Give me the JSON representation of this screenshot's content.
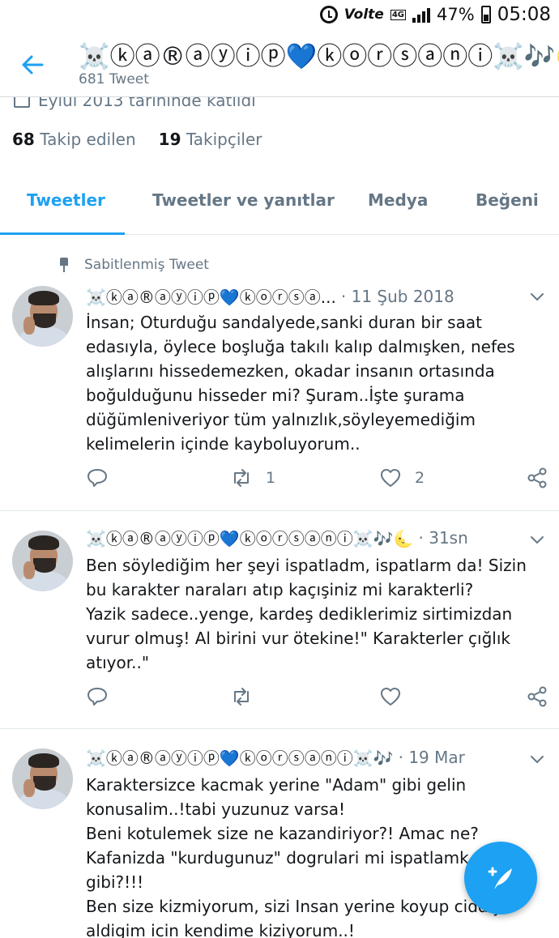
{
  "status_bar": {
    "network": "Volte",
    "network_type": "4G",
    "battery": "47%",
    "time": "05:08",
    "icons": [
      "alarm-icon",
      "signal-icon",
      "battery-icon"
    ]
  },
  "header": {
    "display_name": "☠️ⓚⓐ®ⓐⓨⓘⓟ💙ⓚⓞⓡⓢⓐⓝⓘ☠️🎶🌜",
    "tweet_count": "681 Tweet"
  },
  "profile": {
    "joined": "Eylül 2013 tarihinde katıldı",
    "following_count": "68",
    "following_label": "Takip edilen",
    "followers_count": "19",
    "followers_label": "Takipçiler"
  },
  "tabs": [
    {
      "label": "Tweetler"
    },
    {
      "label": "Tweetler ve yanıtlar"
    },
    {
      "label": "Medya"
    },
    {
      "label": "Beğeni"
    }
  ],
  "tweets": [
    {
      "pinned_label": "Sabitlenmiş Tweet",
      "name": "☠️ⓚⓐ®ⓐⓨⓘⓟ💙ⓚⓞⓡⓢⓐ...",
      "time": "· 11 Şub 2018",
      "text": "İnsan; Oturduğu sandalyede,sanki duran bir saat\nedasıyla, öylece boşluğa takılı kalıp dalmışken, nefes\nalışlarını hissedemezken, okadar insanın ortasında\nboğulduğunu hisseder mi? Şuram..İşte şurama\ndüğümleniveriyor tüm yalnızlık,söyleyemediğim\nkelimelerin içinde kayboluyorum..",
      "retweets": "1",
      "likes": "2"
    },
    {
      "name": "☠️ⓚⓐ®ⓐⓨⓘⓟ💙ⓚⓞⓡⓢⓐⓝⓘ☠️🎶🌜",
      "time": "· 31sn",
      "text": "Ben söylediğim her şeyi ispatladm, ispatlarm da! Sizin\nbu karakter naraları atıp kaçışiniz mi karakterli?\nYazik sadece..yenge, kardeş dediklerimiz sirtimizdan\nvurur olmuş! Al birini vur ötekine!\" Karakterler çığlık\natıyor..\"",
      "retweets": "",
      "likes": ""
    },
    {
      "name": "☠️ⓚⓐ®ⓐⓨⓘⓟ💙ⓚⓞⓡⓢⓐⓝⓘ☠️🎶",
      "time": "· 19 Mar",
      "text": "Karaktersizce kacmak yerine \"Adam\" gibi gelin\nkonusalim..!tabi yuzunuz varsa!\nBeni kotulemek size ne kazandiriyor?! Amac ne?\nKafanizda \"kurdugunuz\" dogrulari mi ispatlamk\ngibi?!!!\nBen size kizmiyorum, sizi Insan yerine koyup ciddiye\naldigim icin kendime kiziyorum..!",
      "retweets": "",
      "likes": ""
    }
  ],
  "colors": {
    "accent": "#1da1f2",
    "secondary_text": "#657786",
    "primary_text": "#14171a"
  }
}
